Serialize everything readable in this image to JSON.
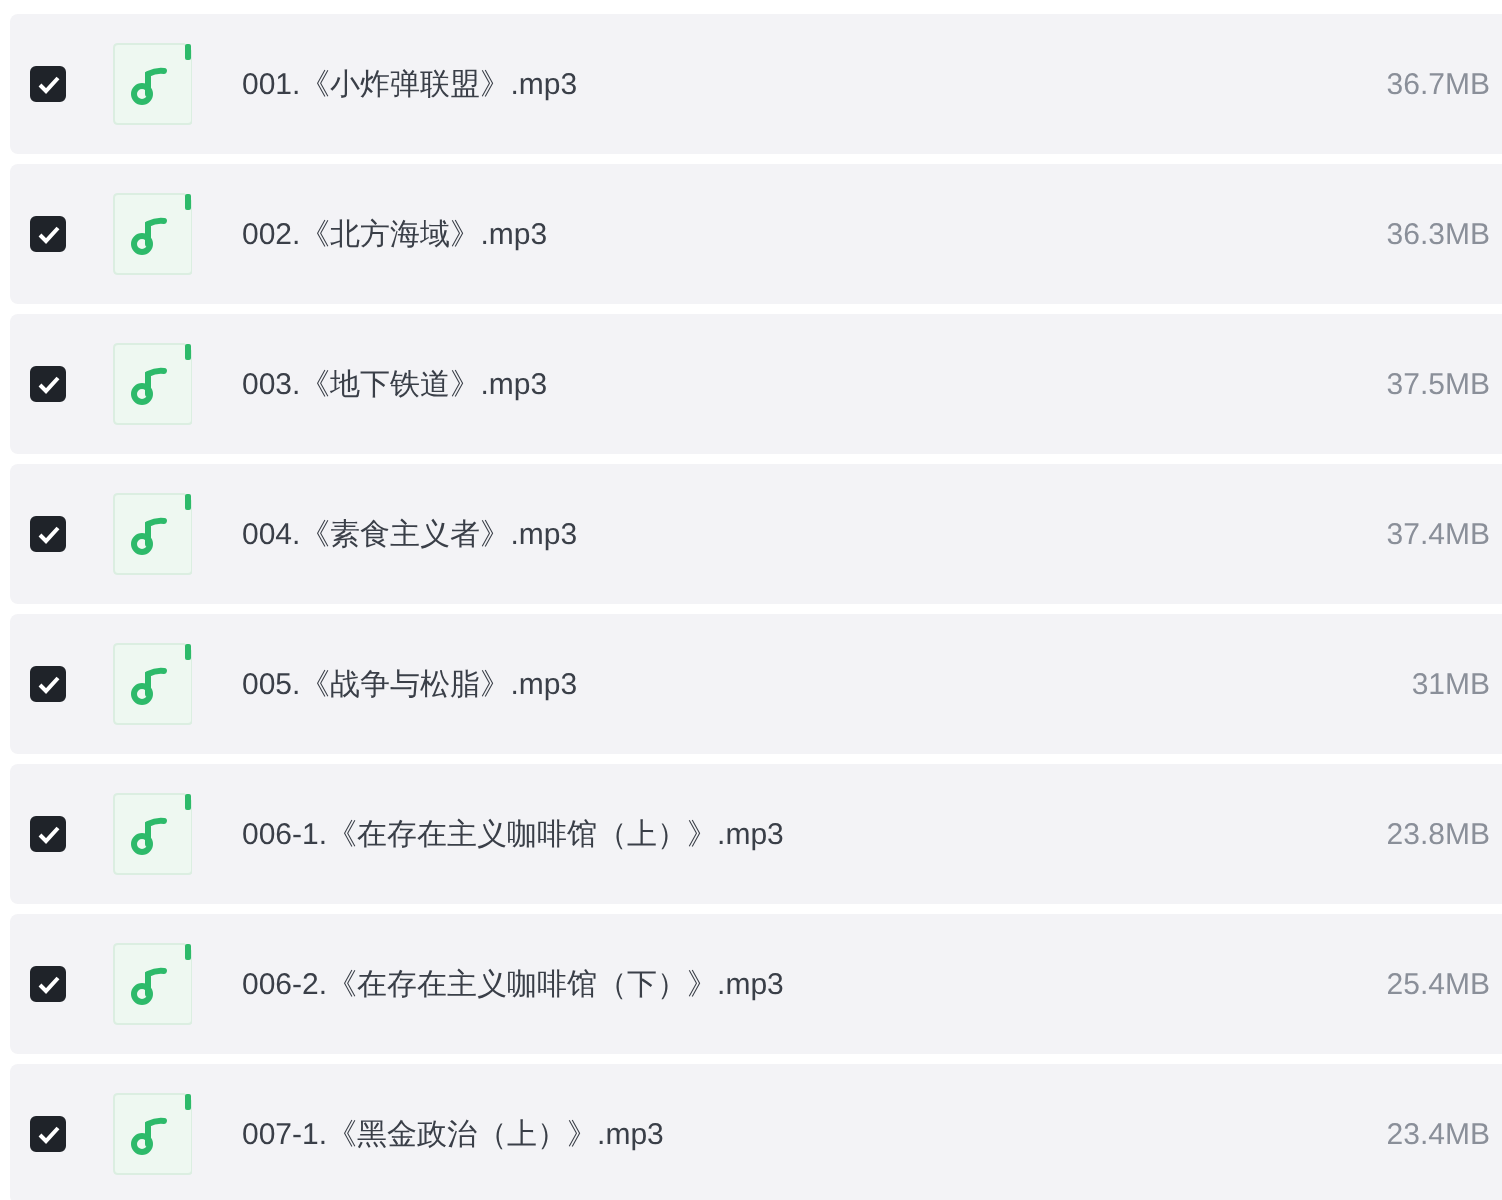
{
  "files": [
    {
      "name": "001.《小炸弹联盟》.mp3",
      "size": "36.7MB",
      "checked": true
    },
    {
      "name": "002.《北方海域》.mp3",
      "size": "36.3MB",
      "checked": true
    },
    {
      "name": "003.《地下铁道》.mp3",
      "size": "37.5MB",
      "checked": true
    },
    {
      "name": "004.《素食主义者》.mp3",
      "size": "37.4MB",
      "checked": true
    },
    {
      "name": "005.《战争与松脂》.mp3",
      "size": "31MB",
      "checked": true
    },
    {
      "name": "006-1.《在存在主义咖啡馆（上）》.mp3",
      "size": "23.8MB",
      "checked": true
    },
    {
      "name": "006-2.《在存在主义咖啡馆（下）》.mp3",
      "size": "25.4MB",
      "checked": true
    },
    {
      "name": "007-1.《黑金政治（上）》.mp3",
      "size": "23.4MB",
      "checked": true
    }
  ]
}
